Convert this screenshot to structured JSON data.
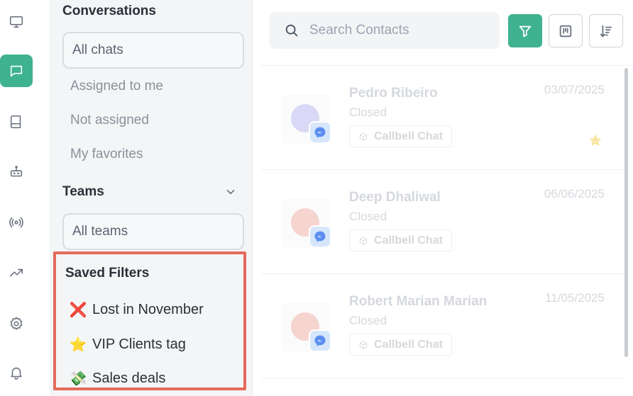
{
  "rail": {
    "items": [
      {
        "name": "desktop-icon",
        "active": false
      },
      {
        "name": "chat-icon",
        "active": true
      },
      {
        "name": "book-icon",
        "active": false
      },
      {
        "name": "bot-icon",
        "active": false
      },
      {
        "name": "broadcast-icon",
        "active": false
      },
      {
        "name": "trending-icon",
        "active": false
      },
      {
        "name": "settings-icon",
        "active": false
      },
      {
        "name": "bell-icon",
        "active": false
      }
    ]
  },
  "filters": {
    "conversations_title": "Conversations",
    "all_chats": "All chats",
    "items": [
      "Assigned to me",
      "Not assigned",
      "My favorites"
    ],
    "teams_title": "Teams",
    "all_teams": "All teams",
    "saved_title": "Saved Filters",
    "saved": [
      {
        "emoji": "❌",
        "label": "Lost in November"
      },
      {
        "emoji": "⭐",
        "label": "VIP Clients tag"
      },
      {
        "emoji": "💸",
        "label": "Sales deals"
      }
    ]
  },
  "search": {
    "placeholder": "Search Contacts"
  },
  "toolbar": {
    "filter_icon": "filter-icon",
    "board_icon": "kanban-icon",
    "sort_icon": "sort-icon"
  },
  "contacts": [
    {
      "name": "Pedro Ribeiro",
      "status": "Closed",
      "date": "03/07/2025",
      "channel": "Callbell Chat",
      "favorite": true
    },
    {
      "name": "Deep Dhaliwal",
      "status": "Closed",
      "date": "06/06/2025",
      "channel": "Callbell Chat",
      "favorite": false
    },
    {
      "name": "Robert Marian Marian",
      "status": "Closed",
      "date": "11/05/2025",
      "channel": "Callbell Chat",
      "favorite": false
    }
  ],
  "colors": {
    "accent": "#3fb28f",
    "highlight": "#e56a5b"
  }
}
